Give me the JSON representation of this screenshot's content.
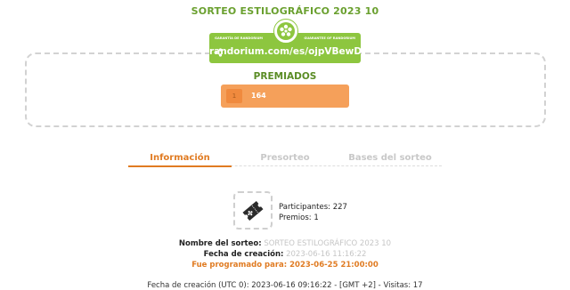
{
  "page": {
    "title": "SORTEO ESTILOGRÁFICO 2023 10"
  },
  "badge": {
    "left_text": "GARANTÍA DE RANDORIUM",
    "right_text": "GUARANTEE OF RANDORIUM",
    "url": "randorium.com/es/ojpVBewD",
    "color": "#8dc63f"
  },
  "results": {
    "heading": "PREMIADOS",
    "winners": [
      {
        "position": "1",
        "value": "164"
      }
    ]
  },
  "tabs": [
    {
      "label": "Información",
      "active": true
    },
    {
      "label": "Presorteo",
      "active": false
    },
    {
      "label": "Bases del sorteo",
      "active": false
    }
  ],
  "info": {
    "participants": "Participantes: 227",
    "prizes": "Premios: 1",
    "name_label": "Nombre del sorteo:",
    "name_value": "SORTEO ESTILOGRÁFICO 2023 10",
    "created_label": "Fecha de creación:",
    "created_value": "2023-06-16 11:16:22",
    "scheduled_label": "Fue programado para:",
    "scheduled_value": "2023-06-25 21:00:00",
    "footer": "Fecha de creación (UTC 0): 2023-06-16 09:16:22 - [GMT +2] - Visitas: 17"
  },
  "colors": {
    "accent": "#e07b22",
    "green": "#6aa02f",
    "prize_bar": "#f5a05a"
  }
}
